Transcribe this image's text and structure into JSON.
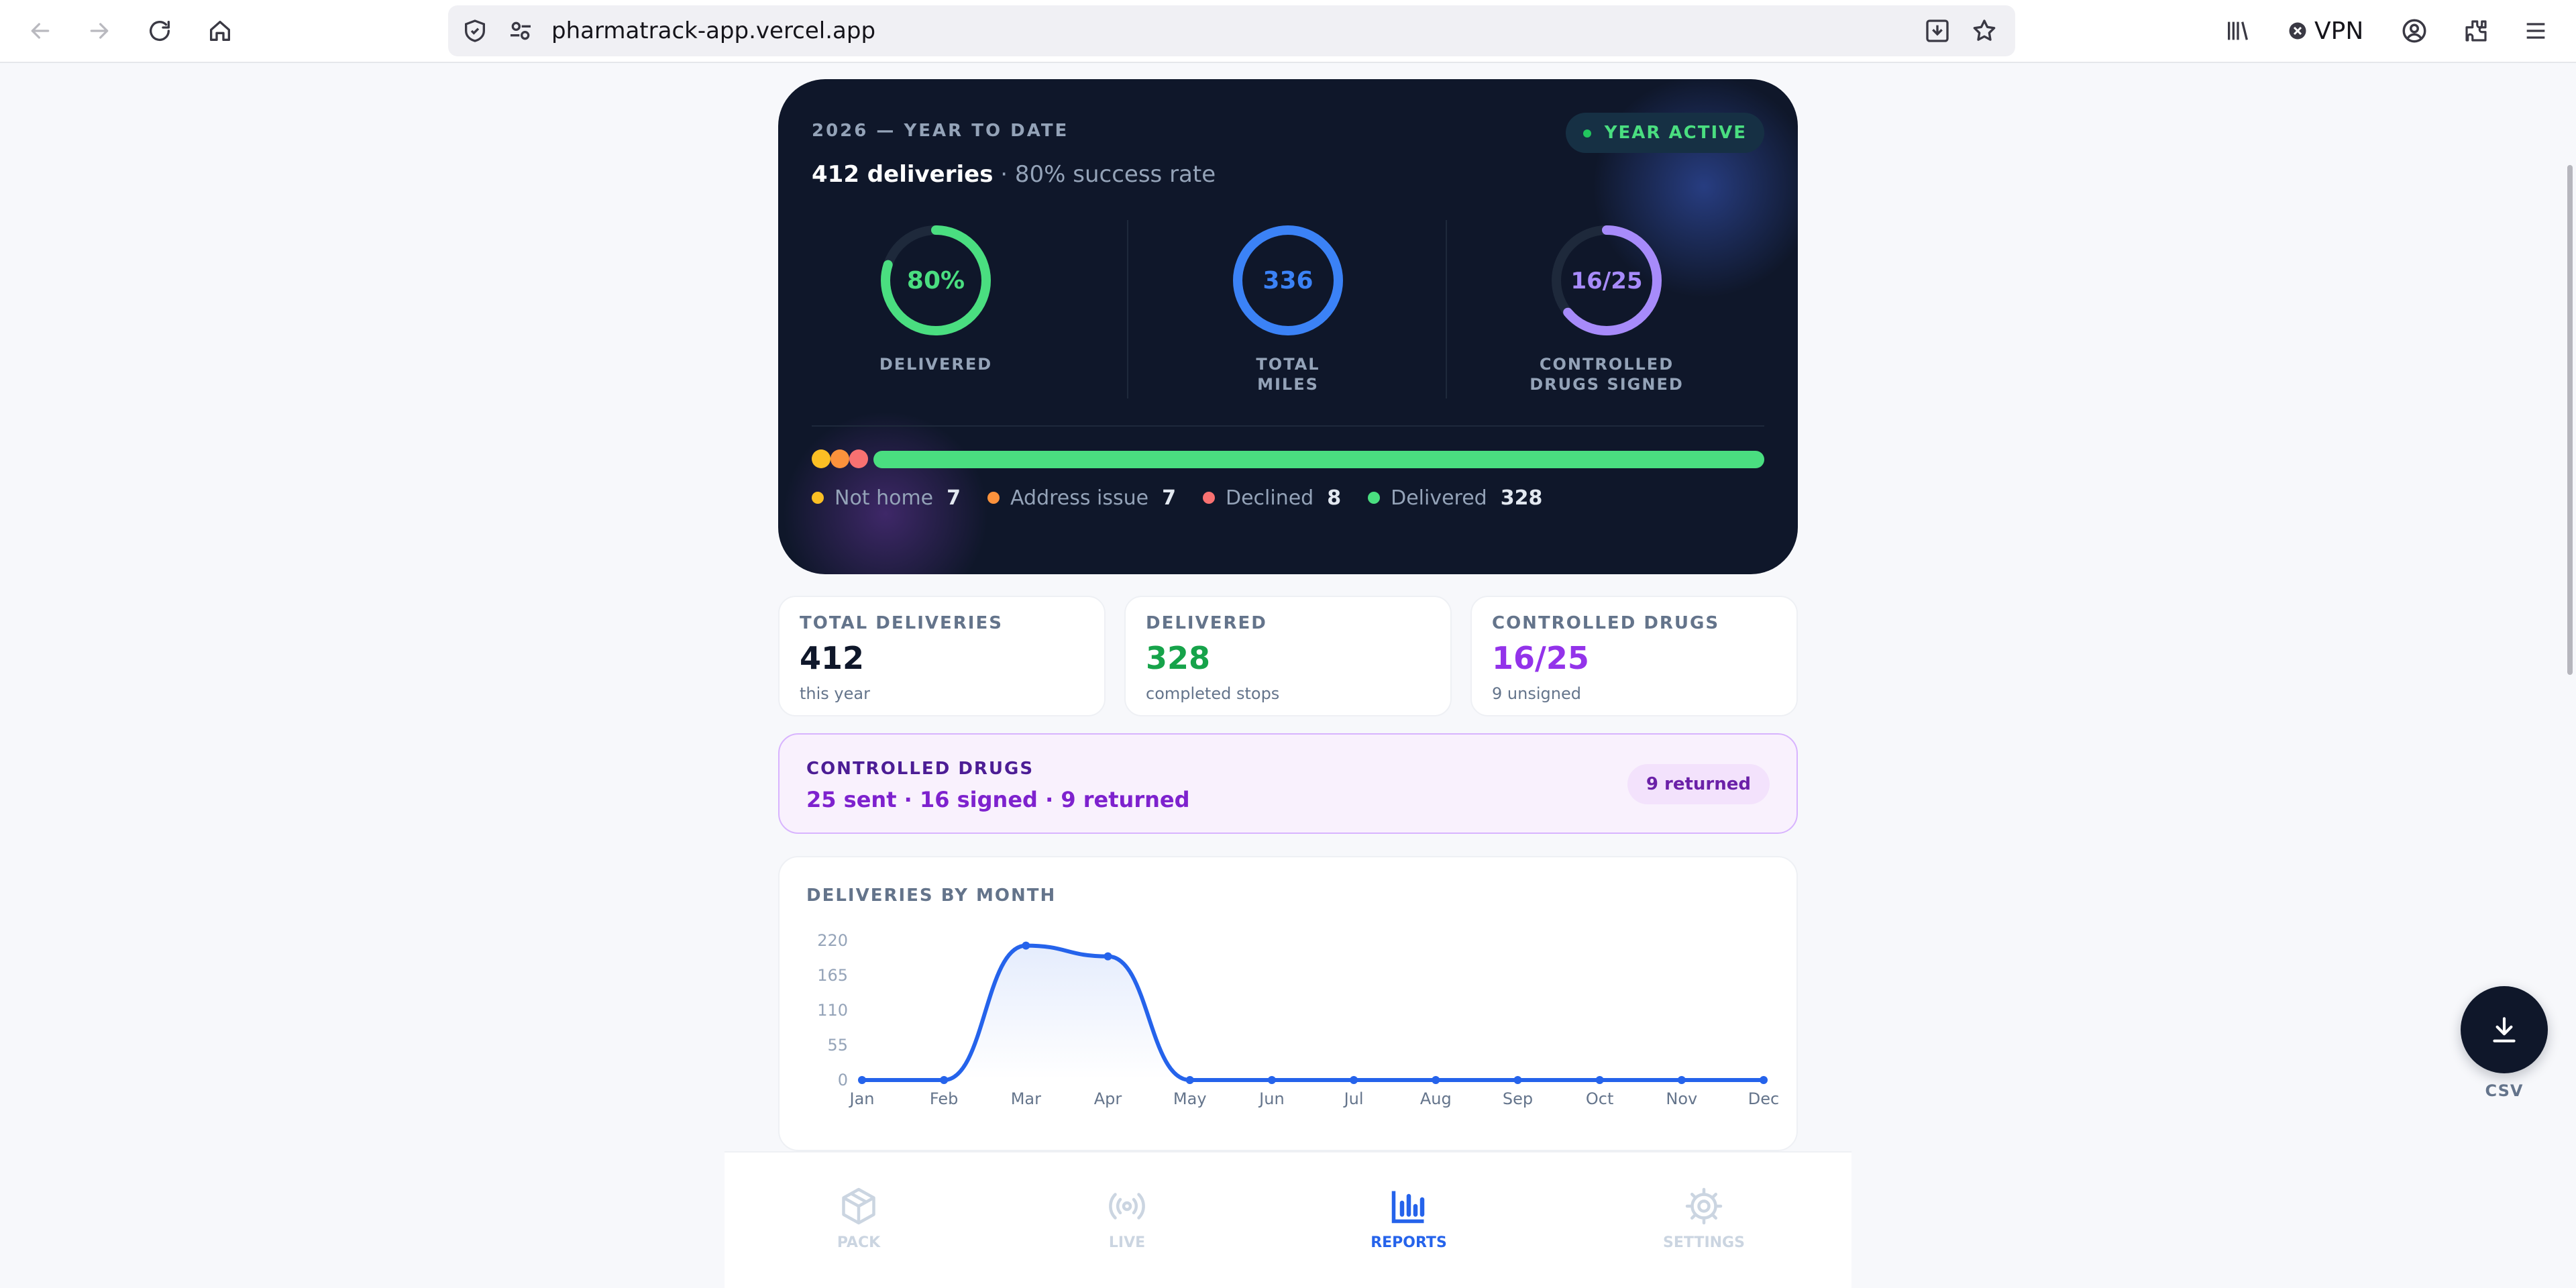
{
  "browser": {
    "url": "pharmatrack-app.vercel.app",
    "vpn_label": "VPN"
  },
  "year_card": {
    "eyebrow": "2026 — YEAR TO DATE",
    "deliveries_text": "412 deliveries",
    "success_text": " · 80% success rate",
    "status_pill": "YEAR ACTIVE",
    "rings": [
      {
        "value_text": "80%",
        "label": "DELIVERED",
        "fraction": 0.8,
        "color": "#4ade80"
      },
      {
        "value_text": "336",
        "label": "TOTAL MILES",
        "fraction": 1.0,
        "color": "#3b82f6"
      },
      {
        "value_text": "16/25",
        "label": "CONTROLLED DRUGS SIGNED",
        "fraction": 0.64,
        "color": "#a78bfa"
      }
    ],
    "outcomes": [
      {
        "name": "Not home",
        "count": "7",
        "color": "#fbbf24"
      },
      {
        "name": "Address issue",
        "count": "7",
        "color": "#fb923c"
      },
      {
        "name": "Declined",
        "count": "8",
        "color": "#f87171"
      },
      {
        "name": "Delivered",
        "count": "328",
        "color": "#4ade80"
      }
    ]
  },
  "stats": [
    {
      "title": "TOTAL DELIVERIES",
      "value": "412",
      "sub": "this year",
      "color": "#0f172a"
    },
    {
      "title": "DELIVERED",
      "value": "328",
      "sub": "completed stops",
      "color": "#16a34a"
    },
    {
      "title": "CONTROLLED DRUGS",
      "value": "16/25",
      "sub": "9 unsigned",
      "color": "#9333ea"
    }
  ],
  "controlled_banner": {
    "title": "CONTROLLED DRUGS",
    "summary": "25 sent · 16 signed · 9 returned",
    "pill": "9 returned"
  },
  "chart_data": {
    "type": "line",
    "title": "DELIVERIES BY MONTH",
    "categories": [
      "Jan",
      "Feb",
      "Mar",
      "Apr",
      "May",
      "Jun",
      "Jul",
      "Aug",
      "Sep",
      "Oct",
      "Nov",
      "Dec"
    ],
    "values": [
      0,
      0,
      212,
      195,
      0,
      0,
      0,
      0,
      0,
      0,
      0,
      0
    ],
    "yticks": [
      0,
      55,
      110,
      165,
      220
    ],
    "ylim": [
      0,
      220
    ],
    "color": "#2563eb",
    "grid": false
  },
  "csv": {
    "label": "CSV"
  },
  "bottom_nav": [
    {
      "label": "PACK",
      "icon": "box-icon",
      "active": false
    },
    {
      "label": "LIVE",
      "icon": "broadcast-icon",
      "active": false
    },
    {
      "label": "REPORTS",
      "icon": "bar-chart-icon",
      "active": true
    },
    {
      "label": "SETTINGS",
      "icon": "gear-icon",
      "active": false
    }
  ],
  "colors": {
    "accent": "#2563eb",
    "dark_card": "#0f172a",
    "inactive_nav": "#cbd5e1"
  }
}
